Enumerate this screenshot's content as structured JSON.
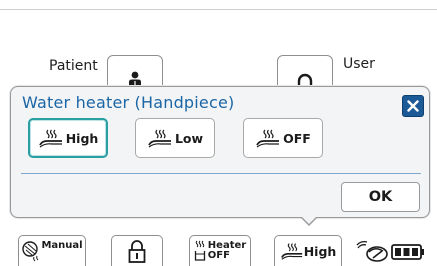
{
  "background": {
    "patient_label": "Patient",
    "user_label": "User",
    "patient_icon": "person-icon",
    "user_icon": "headset-icon"
  },
  "dialog": {
    "title": "Water heater (Handpiece)",
    "close_icon": "close-icon",
    "options": [
      {
        "label": "High",
        "icon": "heat-waves-icon",
        "selected": true
      },
      {
        "label": "Low",
        "icon": "heat-waves-icon",
        "selected": false
      },
      {
        "label": "OFF",
        "icon": "heat-waves-icon",
        "selected": false
      }
    ],
    "ok_label": "OK"
  },
  "toolbar": {
    "manual_label": "Manual",
    "lock_icon": "lock-icon",
    "heater_label": "Heater",
    "heater_state": "OFF",
    "high_label": "High",
    "status_icons": [
      "wireless-icon",
      "battery-icon"
    ]
  },
  "colors": {
    "title": "#1b66a6",
    "close_button": "#1c5a97",
    "selected_border": "#2aa0a3",
    "dialog_background": "#f3f4f5"
  }
}
